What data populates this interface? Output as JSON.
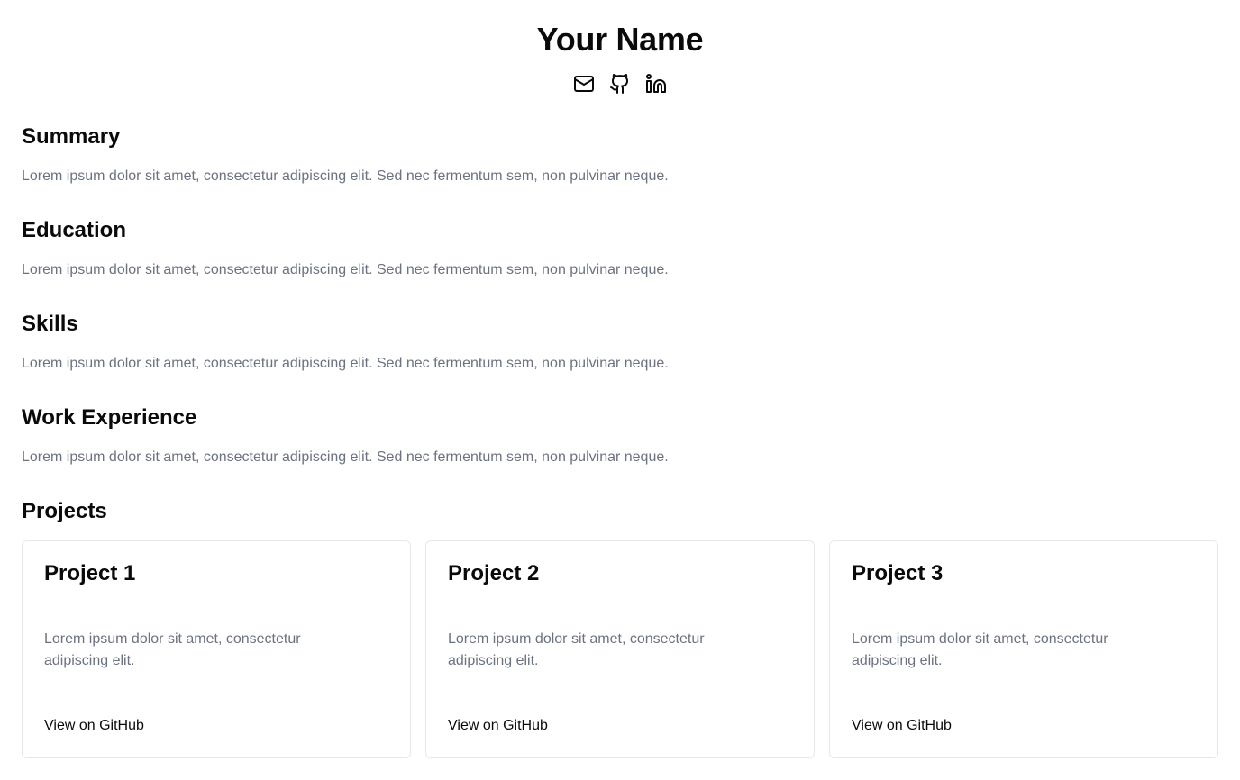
{
  "header": {
    "name": "Your Name",
    "socials": [
      {
        "icon": "mail-icon"
      },
      {
        "icon": "github-icon"
      },
      {
        "icon": "linkedin-icon"
      }
    ]
  },
  "sections": {
    "summary": {
      "title": "Summary",
      "text": "Lorem ipsum dolor sit amet, consectetur adipiscing elit. Sed nec fermentum sem, non pulvinar neque."
    },
    "education": {
      "title": "Education",
      "text": "Lorem ipsum dolor sit amet, consectetur adipiscing elit. Sed nec fermentum sem, non pulvinar neque."
    },
    "skills": {
      "title": "Skills",
      "text": "Lorem ipsum dolor sit amet, consectetur adipiscing elit. Sed nec fermentum sem, non pulvinar neque."
    },
    "work": {
      "title": "Work Experience",
      "text": "Lorem ipsum dolor sit amet, consectetur adipiscing elit. Sed nec fermentum sem, non pulvinar neque."
    },
    "projects": {
      "title": "Projects"
    }
  },
  "projects": [
    {
      "title": "Project 1",
      "description": "Lorem ipsum dolor sit amet, consectetur adipiscing elit.",
      "link_label": "View on GitHub"
    },
    {
      "title": "Project 2",
      "description": "Lorem ipsum dolor sit amet, consectetur adipiscing elit.",
      "link_label": "View on GitHub"
    },
    {
      "title": "Project 3",
      "description": "Lorem ipsum dolor sit amet, consectetur adipiscing elit.",
      "link_label": "View on GitHub"
    }
  ],
  "colors": {
    "text_primary": "#0a0a0a",
    "text_muted": "#6b7280",
    "card_border": "#e5e7eb",
    "background": "#ffffff"
  }
}
